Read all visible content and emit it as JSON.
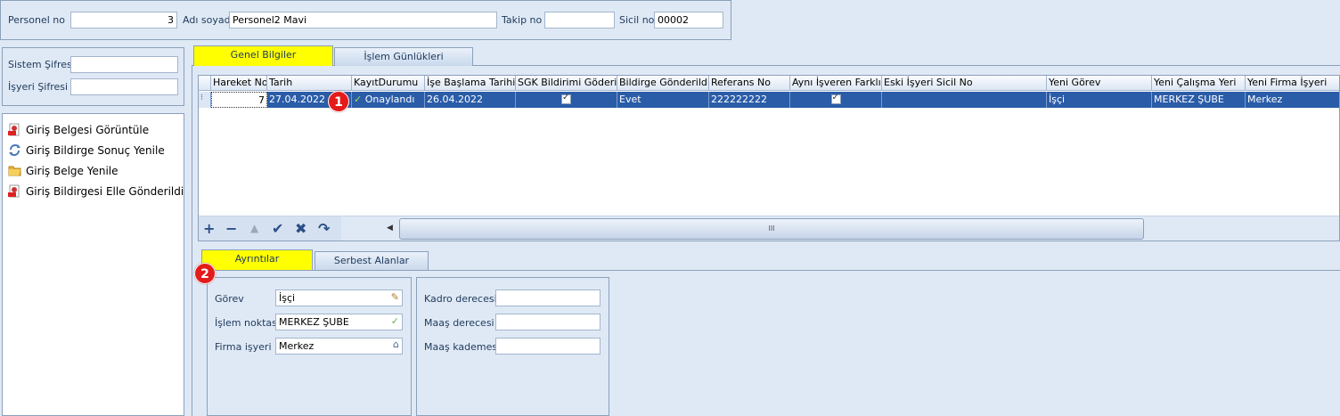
{
  "header": {
    "personel_no_label": "Personel no",
    "personel_no_value": "3",
    "adi_soyadi_label": "Adı soyadı",
    "adi_soyadi_value": "Personel2 Mavi",
    "takip_no_label": "Takip no",
    "takip_no_value": "",
    "sicil_no_label": "Sicil no",
    "sicil_no_value": "00002"
  },
  "passwords": {
    "sistem_label": "Sistem Şifresi",
    "sistem_value": "",
    "isyeri_label": "İşyeri Şifresi",
    "isyeri_value": ""
  },
  "actions": [
    {
      "label": "Giriş Belgesi Görüntüle",
      "icon": "pdf-icon"
    },
    {
      "label": "Giriş Bildirge Sonuç Yenile",
      "icon": "refresh-icon"
    },
    {
      "label": "Giriş Belge Yenile",
      "icon": "folder-icon"
    },
    {
      "label": "Giriş Bildirgesi Elle Gönderildi",
      "icon": "pdf-icon"
    }
  ],
  "top_tabs": [
    "Genel Bilgiler",
    "İşlem Günlükleri"
  ],
  "grid": {
    "columns": [
      "Hareket No",
      "Tarih",
      "KayıtDurumu",
      "İşe Başlama Tarihi",
      "SGK Bildirimi Göderildi",
      "Bildirge Gönderildi",
      "Referans No",
      "Aynı İşveren Farklı İş",
      "Eski İşyeri Sicil No",
      "Yeni Görev",
      "Yeni Çalışma Yeri",
      "Yeni  Firma İşyeri"
    ],
    "row": {
      "hareket_no": "7",
      "tarih": "27.04.2022",
      "kayit_durumu": "Onaylandı",
      "ise_baslama": "26.04.2022",
      "sgk_bildirimi": true,
      "bildirge_gonderildi": "Evet",
      "referans_no": "222222222",
      "ayni_isveren": true,
      "eski_isyeri": "",
      "yeni_gorev": "İşçi",
      "yeni_calisma": "MERKEZ ŞUBE",
      "yeni_firma": "Merkez"
    },
    "scroll_thumb": "III"
  },
  "navigator_icons": [
    "add-icon",
    "remove-icon",
    "up-icon",
    "check-icon",
    "cancel-icon",
    "undo-icon"
  ],
  "bottom_tabs": [
    "Ayrıntılar",
    "Serbest Alanlar"
  ],
  "details": {
    "gorev_label": "Görev",
    "gorev_value": "İşçi",
    "islem_noktasi_label": "İşlem noktası",
    "islem_noktasi_value": "MERKEZ ŞUBE",
    "firma_isyeri_label": "Firma işyeri",
    "firma_isyeri_value": "Merkez",
    "kadro_label": "Kadro derecesi",
    "kadro_value": "",
    "maas_derece_label": "Maaş derecesi",
    "maas_derece_value": "",
    "maas_kademe_label": "Maaş kademesi",
    "maas_kademe_value": ""
  },
  "badges": [
    "1",
    "2"
  ],
  "colors": {
    "active_tab": "#ffff00",
    "selected_row": "#2a5ca8",
    "badge": "#e41b1b"
  }
}
